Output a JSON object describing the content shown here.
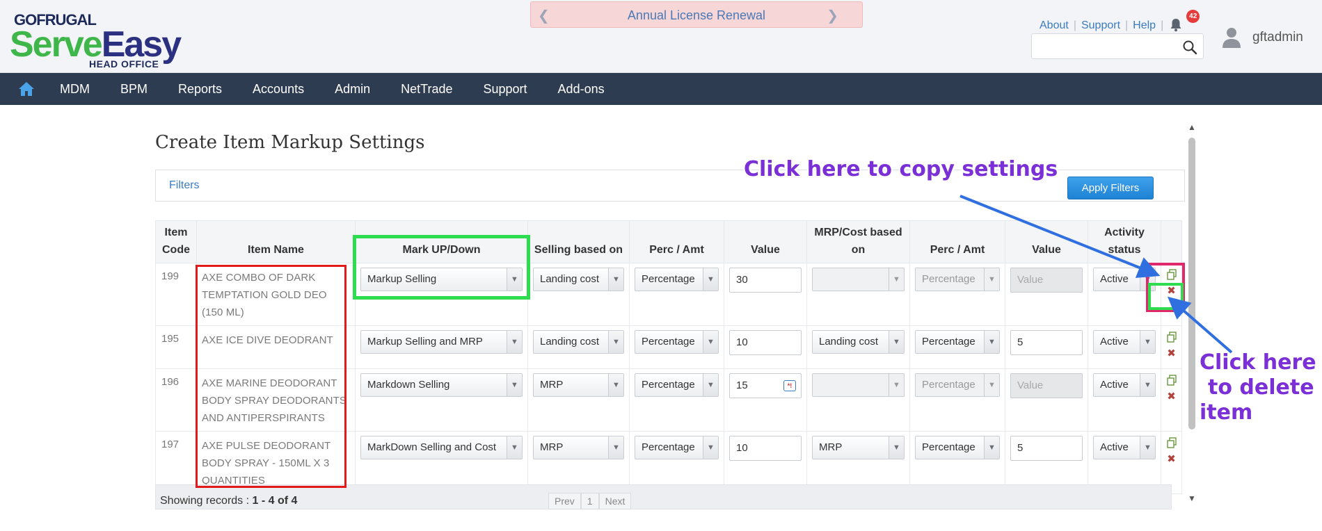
{
  "header": {
    "logo": {
      "top": "GOFRUGAL",
      "serve": "Serve",
      "easy": "Easy",
      "sub": "HEAD OFFICE"
    },
    "banner": {
      "text": "Annual License Renewal",
      "left_arrow_icon": "chevron-left-icon",
      "right_arrow_icon": "chevron-right-icon"
    },
    "links": {
      "about": "About",
      "support": "Support",
      "help": "Help"
    },
    "notifications": {
      "count": "42",
      "icon": "bell-icon"
    },
    "search": {
      "value": "",
      "placeholder": "",
      "icon": "search-icon"
    },
    "user": {
      "name": "gftadmin",
      "icon": "user-avatar-icon"
    }
  },
  "nav": {
    "home_icon": "home-icon",
    "items": [
      "MDM",
      "BPM",
      "Reports",
      "Accounts",
      "Admin",
      "NetTrade",
      "Support",
      "Add-ons"
    ]
  },
  "page": {
    "title": "Create Item Markup Settings",
    "filters_label": "Filters",
    "apply_filters_label": "Apply Filters"
  },
  "table": {
    "headers": {
      "item_code": "Item Code",
      "item_name": "Item Name",
      "markup": "Mark UP/Down",
      "selling_based_on": "Selling based on",
      "perc_amt": "Perc / Amt",
      "value": "Value",
      "mrp_cost_based_on": "MRP/Cost based on",
      "perc_amt2": "Perc / Amt",
      "value2": "Value",
      "activity_status": "Activity status"
    },
    "rows": [
      {
        "code": "199",
        "name": "AXE COMBO OF DARK TEMPTATION GOLD DEO (150 ML)",
        "markup": "Markup Selling",
        "selling_based_on": "Landing cost",
        "perc_amt": "Percentage",
        "value": "30",
        "mrp_cost_based_on": "",
        "perc_amt2": "Percentage",
        "value2": "",
        "value2_placeholder": "Value",
        "status": "Active"
      },
      {
        "code": "195",
        "name": "AXE ICE DIVE DEODRANT",
        "markup": "Markup Selling and MRP",
        "selling_based_on": "Landing cost",
        "perc_amt": "Percentage",
        "value": "10",
        "mrp_cost_based_on": "Landing cost",
        "perc_amt2": "Percentage",
        "value2": "5",
        "value2_placeholder": "",
        "status": "Active"
      },
      {
        "code": "196",
        "name": "AXE MARINE DEODORANT BODY SPRAY DEODORANTS AND ANTIPERSPIRANTS",
        "markup": "Markdown Selling",
        "selling_based_on": "MRP",
        "perc_amt": "Percentage",
        "value": "15",
        "mrp_cost_based_on": "",
        "perc_amt2": "Percentage",
        "value2": "",
        "value2_placeholder": "Value",
        "status": "Active"
      },
      {
        "code": "197",
        "name": "AXE PULSE DEODORANT BODY SPRAY - 150ML X 3 QUANTITIES",
        "markup": "MarkDown Selling and Cost",
        "selling_based_on": "MRP",
        "perc_amt": "Percentage",
        "value": "10",
        "mrp_cost_based_on": "MRP",
        "perc_amt2": "Percentage",
        "value2": "5",
        "value2_placeholder": "",
        "status": "Active"
      }
    ],
    "row_icons": {
      "copy": "copy-icon",
      "delete": "delete-x-icon"
    }
  },
  "footer": {
    "records_prefix": "Showing records : ",
    "records_range": "1 - 4 of 4",
    "pager": {
      "prev": "Prev",
      "page": "1",
      "next": "Next"
    }
  },
  "annotations": {
    "copy_text": "Click here to copy settings",
    "delete_text_lines": [
      "Click here",
      "to delete",
      "item"
    ],
    "colors": {
      "text": "#7b2fd6",
      "arrow": "#2f6fe0",
      "red_box": "#e21a1a",
      "green_box": "#2ddc4f",
      "pink_box": "#e0296b"
    }
  }
}
